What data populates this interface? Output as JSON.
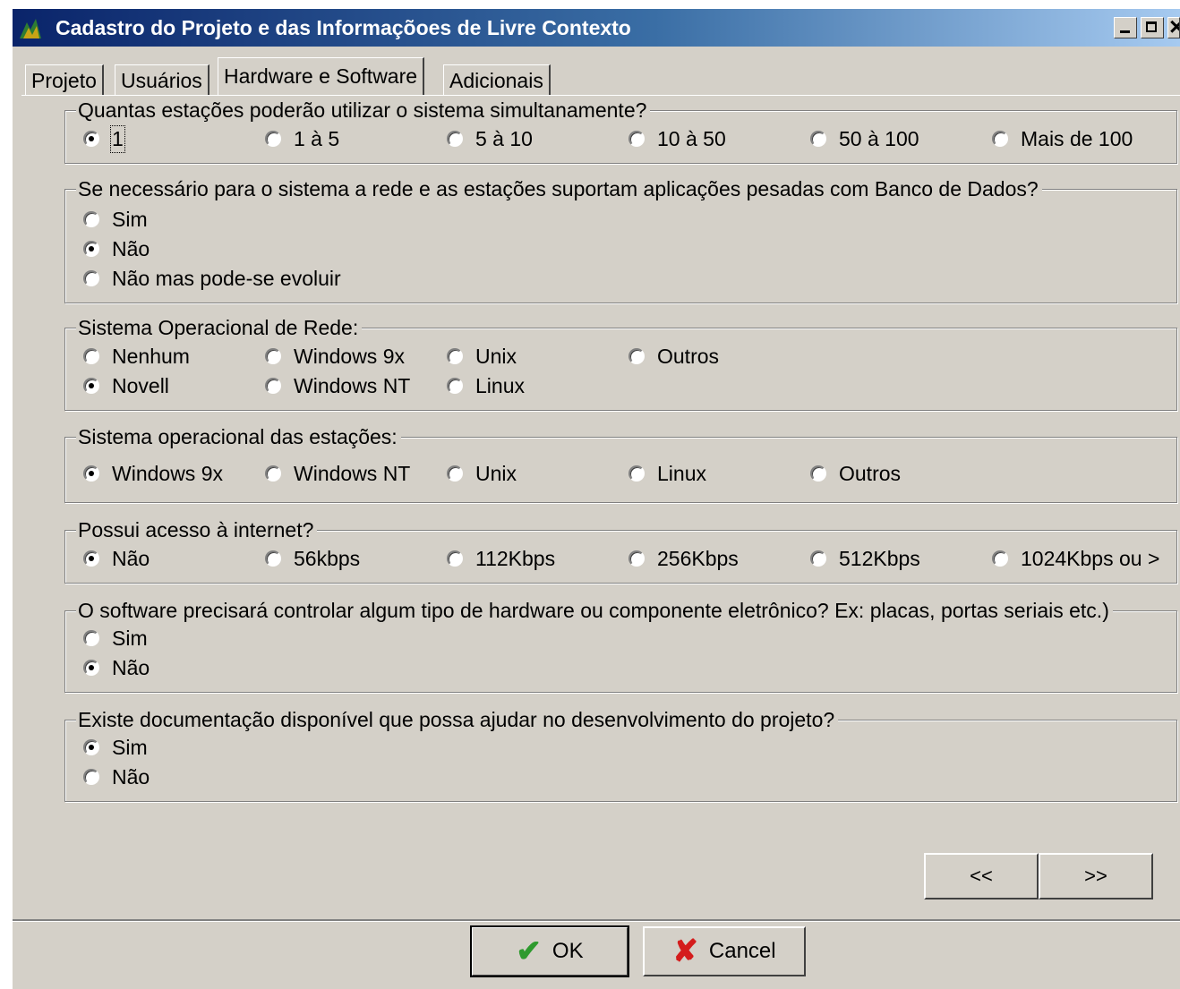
{
  "window": {
    "title": "Cadastro do Projeto e das Informaçõoes de Livre Contexto"
  },
  "tabs": [
    {
      "label": "Projeto",
      "active": false
    },
    {
      "label": "Usuários",
      "active": false
    },
    {
      "label": "Hardware e Software",
      "active": true
    },
    {
      "label": "Adicionais",
      "active": false
    }
  ],
  "groups": {
    "estacoes": {
      "legend": "Quantas estações  poderão utilizar o sistema simultanamente?",
      "options": [
        "1",
        "1 à 5",
        "5 à 10",
        "10 à 50",
        "50 à 100",
        "Mais de 100"
      ],
      "selected": "1"
    },
    "rede_bd": {
      "legend": "Se necessário para o sistema a rede e as estações suportam aplicações pesadas com  Banco de Dados?",
      "options": [
        "Sim",
        "Não",
        "Não mas pode-se evoluir"
      ],
      "selected": "Não"
    },
    "so_rede": {
      "legend": "Sistema Operacional de Rede:",
      "options": [
        "Nenhum",
        "Windows 9x",
        "Unix",
        "Outros",
        "Novell",
        "Windows NT",
        "Linux"
      ],
      "selected": "Novell"
    },
    "so_estacoes": {
      "legend": "Sistema operacional das estações:",
      "options": [
        "Windows 9x",
        "Windows NT",
        "Unix",
        "Linux",
        "Outros"
      ],
      "selected": "Windows 9x"
    },
    "internet": {
      "legend": "Possui acesso à internet?",
      "options": [
        "Não",
        "56kbps",
        "112Kbps",
        "256Kbps",
        "512Kbps",
        "1024Kbps ou >"
      ],
      "selected": "Não"
    },
    "hardware": {
      "legend": "O software precisará controlar algum tipo de hardware ou componente eletrônico? Ex: placas, portas seriais etc.)",
      "options": [
        "Sim",
        "Não"
      ],
      "selected": "Não"
    },
    "documentacao": {
      "legend": "Existe documentação disponível que possa ajudar no desenvolvimento do projeto?",
      "options": [
        "Sim",
        "Não"
      ],
      "selected": "Sim"
    }
  },
  "nav": {
    "prev_label": "<<",
    "next_label": ">>"
  },
  "buttons": {
    "ok_label": "OK",
    "cancel_label": "Cancel"
  },
  "icons": {
    "app": "app-icon",
    "ok": "check-icon",
    "cancel": "x-icon"
  },
  "colors": {
    "titlebar_start": "#0a246a",
    "titlebar_end": "#a6caf0",
    "face": "#d4d0c8",
    "ok_icon": "#2e9a2e",
    "cancel_icon": "#d41c1c"
  }
}
